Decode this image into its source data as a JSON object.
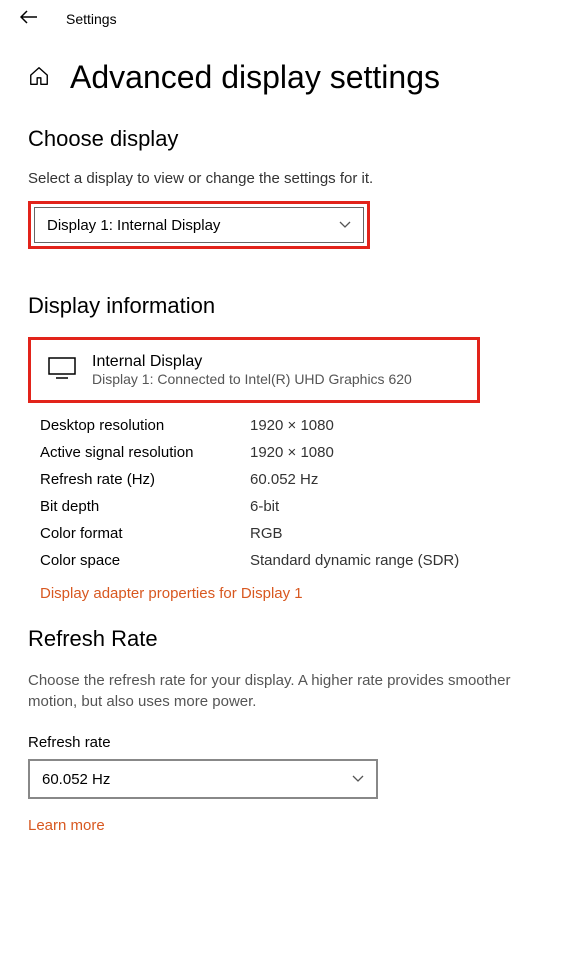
{
  "topbar": {
    "title": "Settings"
  },
  "page": {
    "title": "Advanced display settings"
  },
  "choose": {
    "heading": "Choose display",
    "help": "Select a display to view or change the settings for it.",
    "selected": "Display 1: Internal Display"
  },
  "info": {
    "heading": "Display information",
    "display_name": "Internal Display",
    "display_sub": "Display 1: Connected to Intel(R) UHD Graphics 620",
    "rows": [
      {
        "label": "Desktop resolution",
        "value": "1920 × 1080"
      },
      {
        "label": "Active signal resolution",
        "value": "1920 × 1080"
      },
      {
        "label": "Refresh rate (Hz)",
        "value": "60.052 Hz"
      },
      {
        "label": "Bit depth",
        "value": "6-bit"
      },
      {
        "label": "Color format",
        "value": "RGB"
      },
      {
        "label": "Color space",
        "value": "Standard dynamic range (SDR)"
      }
    ],
    "adapter_link": "Display adapter properties for Display 1"
  },
  "refresh": {
    "heading": "Refresh Rate",
    "help": "Choose the refresh rate for your display. A higher rate provides smoother motion, but also uses more power.",
    "label": "Refresh rate",
    "selected": "60.052 Hz",
    "learn_more": "Learn more"
  }
}
